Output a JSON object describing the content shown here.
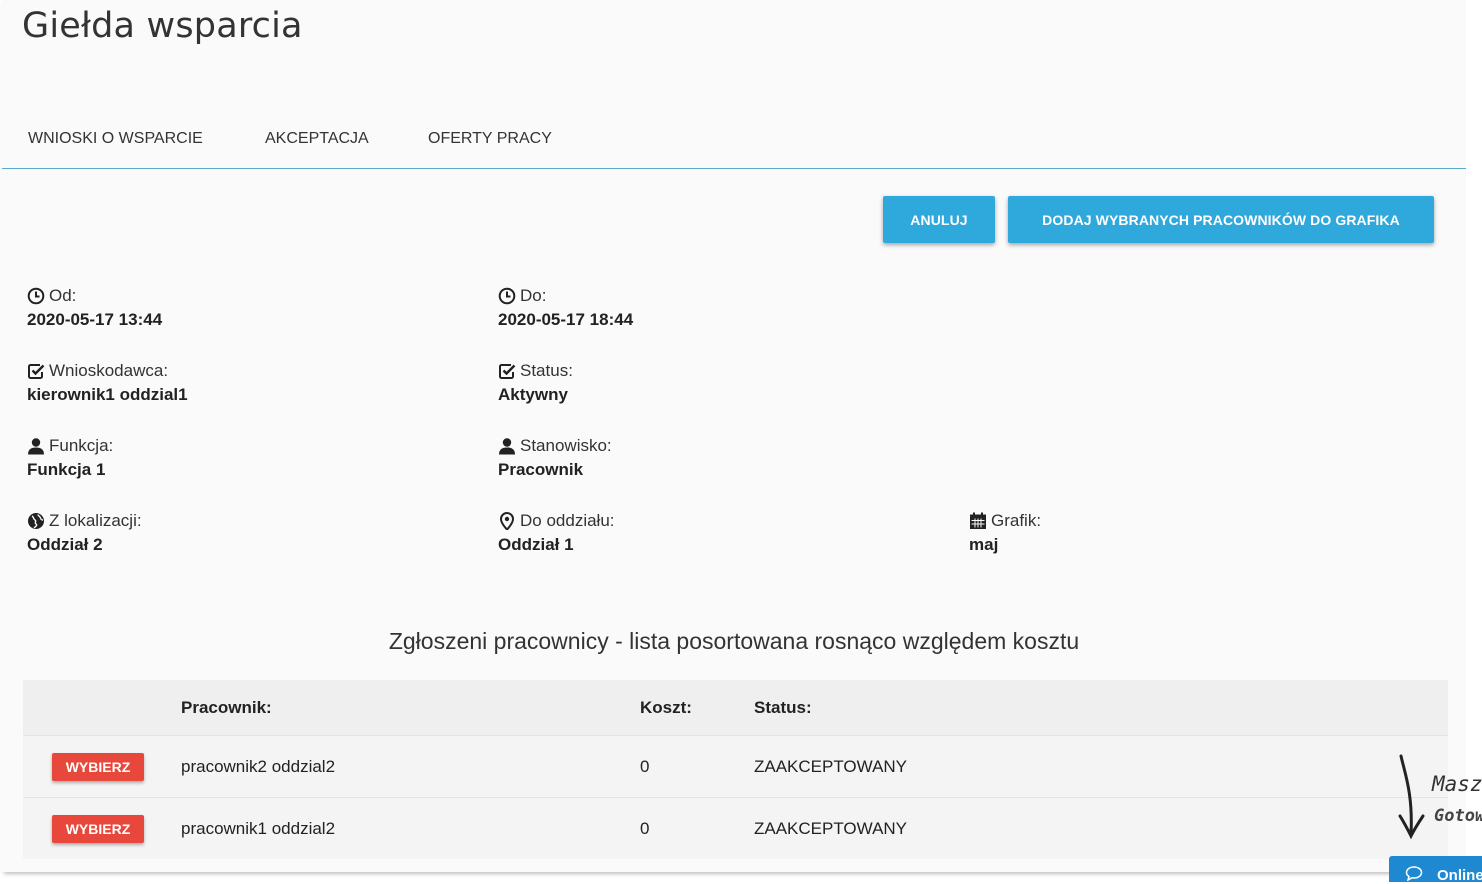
{
  "page": {
    "title": "Giełda wsparcia"
  },
  "tabs": [
    {
      "label": "WNIOSKI O WSPARCIE"
    },
    {
      "label": "AKCEPTACJA"
    },
    {
      "label": "OFERTY PRACY"
    }
  ],
  "actions": {
    "cancel_label": "ANULUJ",
    "add_label": "DODAJ WYBRANYCH PRACOWNIKÓW DO GRAFIKA"
  },
  "details": {
    "from": {
      "label": "Od:",
      "value": "2020-05-17 13:44",
      "icon": "clock-icon"
    },
    "to": {
      "label": "Do:",
      "value": "2020-05-17 18:44",
      "icon": "clock-icon"
    },
    "applicant": {
      "label": "Wnioskodawca:",
      "value": "kierownik1 oddzial1",
      "icon": "edit-check-icon"
    },
    "status": {
      "label": "Status:",
      "value": "Aktywny",
      "icon": "edit-check-icon"
    },
    "function": {
      "label": "Funkcja:",
      "value": "Funkcja 1",
      "icon": "user-icon"
    },
    "position": {
      "label": "Stanowisko:",
      "value": "Pracownik",
      "icon": "user-icon"
    },
    "from_location": {
      "label": "Z lokalizacji:",
      "value": "Oddział 2",
      "icon": "globe-icon"
    },
    "to_branch": {
      "label": "Do oddziału:",
      "value": "Oddział 1",
      "icon": "map-pin-icon"
    },
    "schedule": {
      "label": "Grafik:",
      "value": "maj",
      "icon": "calendar-icon"
    }
  },
  "list": {
    "title": "Zgłoszeni pracownicy - lista posortowana rosnąco względem kosztu",
    "headers": {
      "employee": "Pracownik:",
      "cost": "Koszt:",
      "status": "Status:"
    },
    "rows": [
      {
        "select_label": "WYBIERZ",
        "employee": "pracownik2 oddzial2",
        "cost": "0",
        "status": "ZAAKCEPTOWANY"
      },
      {
        "select_label": "WYBIERZ",
        "employee": "pracownik1 oddzial2",
        "cost": "0",
        "status": "ZAAKCEPTOWANY"
      }
    ]
  },
  "chat_widget": {
    "label": "Online",
    "hint_line1": "Masz",
    "hint_line2": "Gotow",
    "icon": "chat-bubble-icon"
  },
  "colors": {
    "primary": "#2fa8dc",
    "danger": "#e8483b",
    "chat": "#1e88d0",
    "tab_border": "#5aa9cf"
  }
}
